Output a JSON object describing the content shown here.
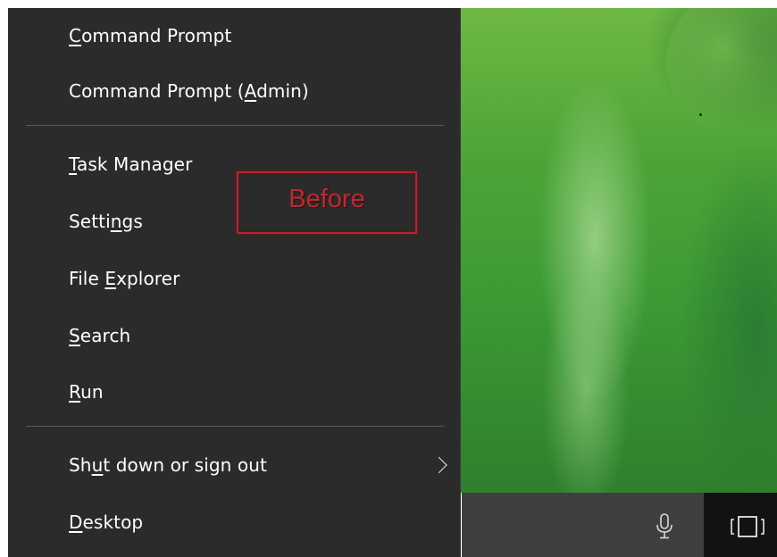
{
  "menu": {
    "items": [
      {
        "pre": "",
        "key": "C",
        "post": "ommand Prompt"
      },
      {
        "pre": "Command Prompt (",
        "key": "A",
        "post": "dmin)"
      },
      {
        "pre": "",
        "key": "T",
        "post": "ask Manager"
      },
      {
        "pre": "Setti",
        "key": "n",
        "post": "gs"
      },
      {
        "pre": "File ",
        "key": "E",
        "post": "xplorer"
      },
      {
        "pre": "",
        "key": "S",
        "post": "earch"
      },
      {
        "pre": "",
        "key": "R",
        "post": "un"
      },
      {
        "pre": "Sh",
        "key": "u",
        "post": "t down or sign out"
      },
      {
        "pre": "",
        "key": "D",
        "post": "esktop"
      }
    ]
  },
  "annotation": {
    "label": "Before",
    "color": "#b92b33"
  },
  "icons": {
    "submenu_arrow": "chevron-right-icon",
    "microphone": "microphone-icon",
    "task_view": "task-view-icon"
  },
  "colors": {
    "menu_background": "#2b2b2b",
    "menu_text": "#ffffff",
    "taskbar_search": "#3f3f3f",
    "taskbar": "#121212"
  }
}
